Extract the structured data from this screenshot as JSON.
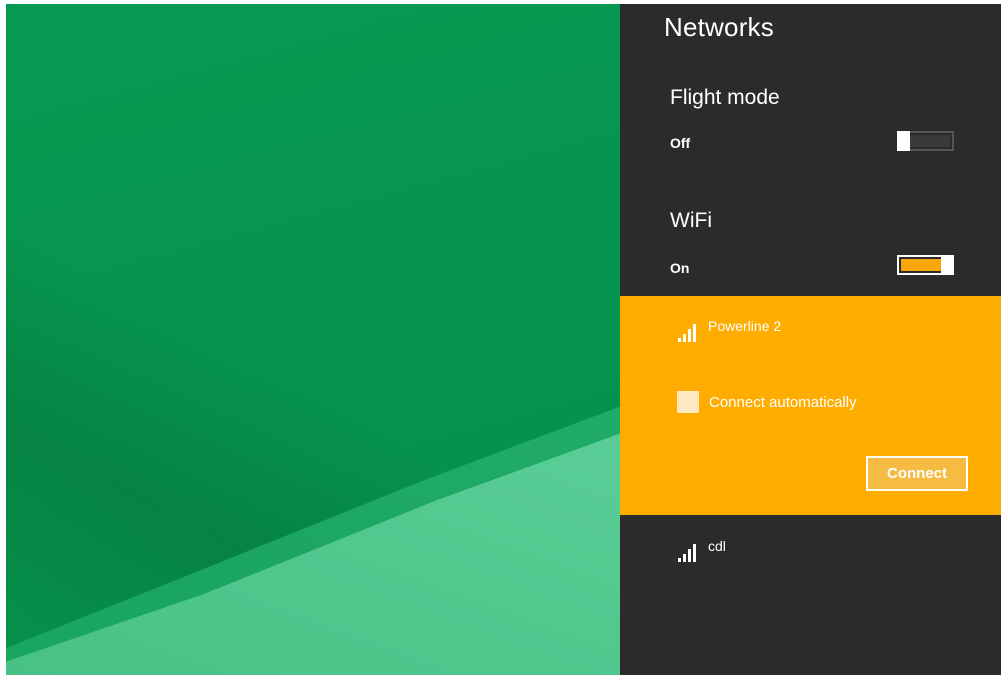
{
  "panel": {
    "title": "Networks"
  },
  "flight_mode": {
    "title": "Flight mode",
    "state_label": "Off",
    "enabled": false
  },
  "wifi": {
    "title": "WiFi",
    "state_label": "On",
    "enabled": true
  },
  "networks": [
    {
      "name": "Powerline 2",
      "selected": true,
      "connect_automatically_label": "Connect automatically",
      "connect_automatically_checked": false,
      "connect_button_label": "Connect"
    },
    {
      "name": "cdl",
      "selected": false
    }
  ],
  "colors": {
    "accent": "#ffac00",
    "panel_background": "#2b2b2b",
    "desktop_green": "#079a52"
  },
  "icons": {
    "signal": "wifi-signal-icon"
  }
}
